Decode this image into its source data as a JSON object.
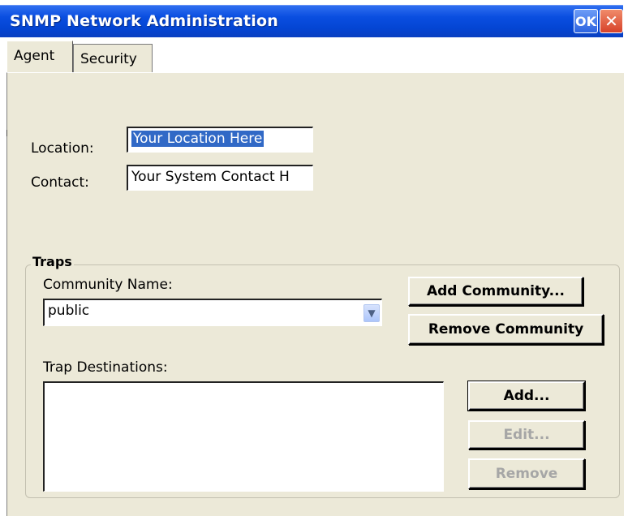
{
  "window": {
    "title": "SNMP Network Administration",
    "ok_label": "OK",
    "close_label": "✕"
  },
  "tabs": [
    {
      "label": "Agent",
      "active": true
    },
    {
      "label": "Security",
      "active": false
    }
  ],
  "agent": {
    "location_label": "Location:",
    "location_value": "Your Location Here",
    "contact_label": "Contact:",
    "contact_value": "Your System Contact H"
  },
  "traps": {
    "group_title": "Traps",
    "community_label": "Community Name:",
    "community_value": "public",
    "add_community_label": "Add Community...",
    "remove_community_label": "Remove Community",
    "destinations_label": "Trap Destinations:",
    "destinations": [],
    "add_label": "Add...",
    "edit_label": "Edit...",
    "remove_label": "Remove"
  },
  "colors": {
    "titlebar": "#0a4ee0",
    "dialog_bg": "#ece9d8",
    "selection": "#3169c6",
    "close_button": "#d7422a"
  }
}
